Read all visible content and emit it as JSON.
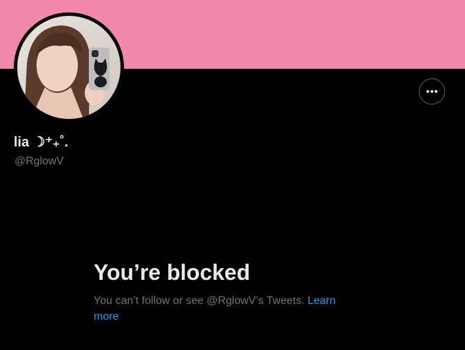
{
  "profile": {
    "display_name": "lia ☽⁺₊˚.",
    "handle": "@RglowV",
    "banner_color": "#f088ab",
    "avatar_icon": "avatar-photo"
  },
  "header": {
    "more_icon": "more-horizontal-icon"
  },
  "blocked": {
    "title": "You’re blocked",
    "description": "You can’t follow or see @RglowV’s Tweets.",
    "learn_more": "Learn more"
  }
}
